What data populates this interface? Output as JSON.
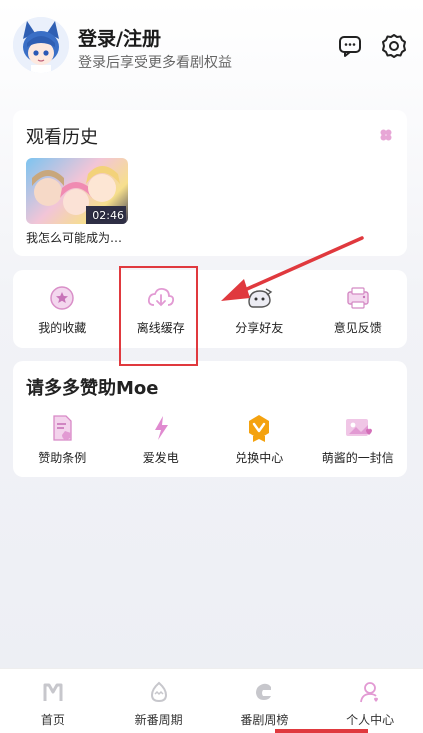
{
  "header": {
    "title": "登录/注册",
    "subtitle": "登录后享受更多看剧权益",
    "icons": [
      "message-icon",
      "settings-icon"
    ]
  },
  "history": {
    "title": "观看历史",
    "items": [
      {
        "title": "我怎么可能成为…",
        "duration": "02:46"
      }
    ]
  },
  "quick": {
    "items": [
      {
        "label": "我的收藏",
        "icon": "favorites-icon"
      },
      {
        "label": "离线缓存",
        "icon": "download-icon"
      },
      {
        "label": "分享好友",
        "icon": "share-icon"
      },
      {
        "label": "意见反馈",
        "icon": "feedback-icon"
      }
    ]
  },
  "sponsor": {
    "title": "请多多赞助Moe",
    "items": [
      {
        "label": "赞助条例",
        "icon": "terms-icon"
      },
      {
        "label": "爱发电",
        "icon": "lightning-icon"
      },
      {
        "label": "兑换中心",
        "icon": "redeem-icon"
      },
      {
        "label": "萌酱的一封信",
        "icon": "letter-icon"
      }
    ]
  },
  "tabbar": {
    "tabs": [
      {
        "label": "首页",
        "icon": "home-icon"
      },
      {
        "label": "新番周期",
        "icon": "egg-icon"
      },
      {
        "label": "番剧周榜",
        "icon": "ranking-icon"
      },
      {
        "label": "个人中心",
        "icon": "user-icon"
      }
    ],
    "active": "个人中心"
  },
  "colors": {
    "accent_pink": "#e7a6d6",
    "annotation_red": "#e0393e",
    "badge_orange": "#f4a20f"
  }
}
